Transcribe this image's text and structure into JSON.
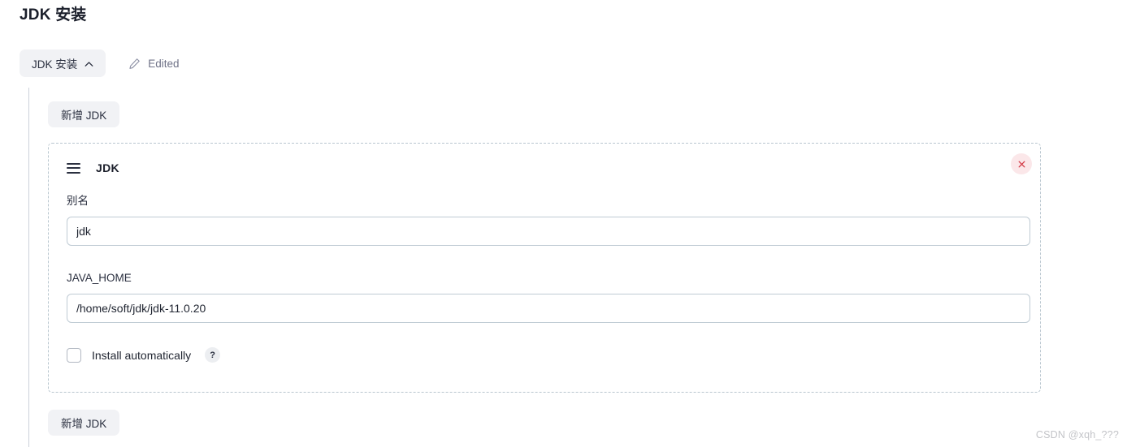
{
  "page": {
    "title": "JDK 安装",
    "watermark": "CSDN @xqh_???"
  },
  "stage": {
    "pill_label": "JDK 安装",
    "collapse_icon": "chevron-up-icon",
    "edit_icon": "pencil-icon",
    "edited_label": "Edited"
  },
  "section": {
    "add_button_top_label": "新增 JDK",
    "add_button_bottom_label": "新增 JDK"
  },
  "block": {
    "drag_icon": "drag-handle-icon",
    "title": "JDK",
    "close_icon": "close-icon",
    "fields": [
      {
        "label": "别名",
        "value": "jdk",
        "placeholder": ""
      },
      {
        "label": "JAVA_HOME",
        "value": "/home/soft/jdk/jdk-11.0.20",
        "placeholder": ""
      }
    ],
    "checkbox": {
      "label": "Install automatically",
      "checked": false,
      "help_label": "?"
    }
  },
  "colors": {
    "pill_bg": "#f1f2f5",
    "dashed_border": "#b9c6cf",
    "input_border": "#bfcbd4",
    "close_bg": "#fbe7e9",
    "close_glyph": "#d33a46",
    "text_primary": "#1f2430",
    "text_muted": "#6f7287",
    "watermark": "#c3c4c8"
  }
}
